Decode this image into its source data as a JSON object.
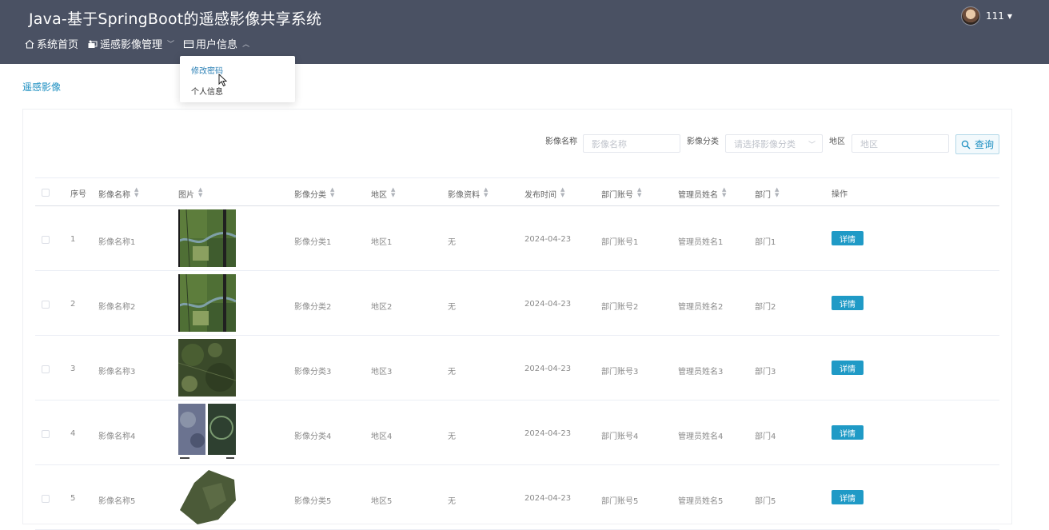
{
  "app": {
    "title": "Java-基于SpringBoot的遥感影像共享系统"
  },
  "user": {
    "name": "111"
  },
  "nav": {
    "items": [
      {
        "label": "系统首页",
        "icon": "home-icon"
      },
      {
        "label": "遥感影像管理",
        "icon": "image-stack-icon"
      },
      {
        "label": "用户信息",
        "icon": "id-card-icon"
      }
    ]
  },
  "dropdown": {
    "items": [
      "修改密码",
      "个人信息"
    ]
  },
  "breadcrumb": "遥感影像",
  "search": {
    "name_label": "影像名称",
    "name_placeholder": "影像名称",
    "category_label": "影像分类",
    "category_placeholder": "请选择影像分类",
    "region_label": "地区",
    "region_placeholder": "地区",
    "query_label": "查询"
  },
  "table": {
    "columns": [
      "序号",
      "影像名称",
      "图片",
      "影像分类",
      "地区",
      "影像资料",
      "发布时间",
      "部门账号",
      "管理员姓名",
      "部门",
      "操作"
    ],
    "rows": [
      {
        "index": "1",
        "name": "影像名称1",
        "category": "影像分类1",
        "region": "地区1",
        "material": "无",
        "date": "2024-04-23",
        "account": "部门账号1",
        "admin": "管理员姓名1",
        "dept": "部门1",
        "action": "详情"
      },
      {
        "index": "2",
        "name": "影像名称2",
        "category": "影像分类2",
        "region": "地区2",
        "material": "无",
        "date": "2024-04-23",
        "account": "部门账号2",
        "admin": "管理员姓名2",
        "dept": "部门2",
        "action": "详情"
      },
      {
        "index": "3",
        "name": "影像名称3",
        "category": "影像分类3",
        "region": "地区3",
        "material": "无",
        "date": "2024-04-23",
        "account": "部门账号3",
        "admin": "管理员姓名3",
        "dept": "部门3",
        "action": "详情"
      },
      {
        "index": "4",
        "name": "影像名称4",
        "category": "影像分类4",
        "region": "地区4",
        "material": "无",
        "date": "2024-04-23",
        "account": "部门账号4",
        "admin": "管理员姓名4",
        "dept": "部门4",
        "action": "详情"
      },
      {
        "index": "5",
        "name": "影像名称5",
        "category": "影像分类5",
        "region": "地区5",
        "material": "无",
        "date": "2024-04-23",
        "account": "部门账号5",
        "admin": "管理员姓名5",
        "dept": "部门5",
        "action": "详情"
      }
    ]
  },
  "colors": {
    "header": "#4a5163",
    "accent": "#1f9ac6",
    "link": "#1d8fc1"
  }
}
